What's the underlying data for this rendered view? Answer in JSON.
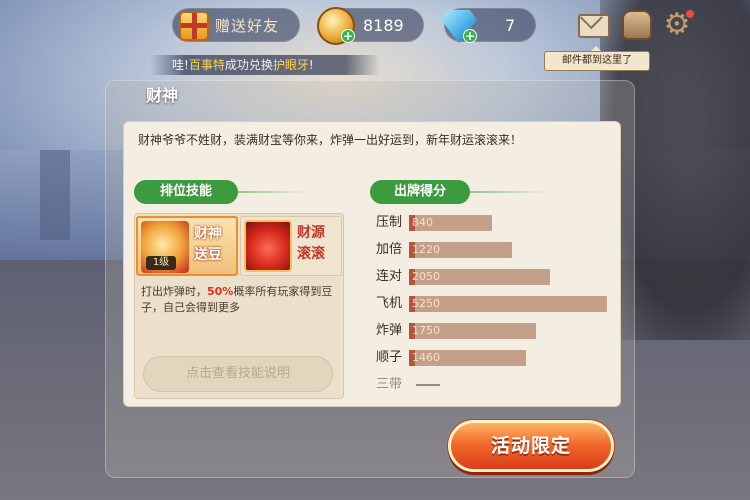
{
  "topbar": {
    "gift_label": "赠送好友",
    "coins": "8189",
    "gems": "7",
    "mail_tooltip": "邮件都到这里了"
  },
  "marquee": {
    "prefix": "哇!",
    "highlight1": "百事特",
    "middle": "成功兑换",
    "highlight2": "护眼牙",
    "suffix": "!"
  },
  "panel": {
    "title": "财神",
    "intro": "财神爷爷不姓财，装满财宝等你来，炸弹一出好运到，新年财运滚滚来！",
    "skills_tag": "排位技能",
    "scores_tag": "出牌得分"
  },
  "skills": {
    "cards": [
      {
        "name": "财神送豆",
        "badge": "1级",
        "selected": true
      },
      {
        "name": "财源滚滚",
        "selected": false
      }
    ],
    "desc_pre": "打出炸弹时，",
    "desc_highlight": "50%",
    "desc_post": "概率所有玩家得到豆子，自己会得到更多",
    "button": "点击查看技能说明"
  },
  "scores": [
    {
      "label": "压制",
      "value": "840",
      "level": 0.42
    },
    {
      "label": "加倍",
      "value": "1220",
      "level": 0.52
    },
    {
      "label": "连对",
      "value": "2050",
      "level": 0.71
    },
    {
      "label": "飞机",
      "value": "5250",
      "level": 1.0
    },
    {
      "label": "炸弹",
      "value": "1750",
      "level": 0.64
    },
    {
      "label": "顺子",
      "value": "1460",
      "level": 0.59
    },
    {
      "label": "三带",
      "value": "",
      "level": 0
    }
  ],
  "cta": {
    "label": "活动限定"
  },
  "colors": {
    "accent_green": "#3c9b3f",
    "bar_fill": "#b7543d",
    "cta_orange": "#f26b2a"
  },
  "icons": [
    "gift-icon",
    "coin-icon",
    "gem-icon",
    "mail-icon",
    "bag-icon",
    "gear-icon"
  ]
}
